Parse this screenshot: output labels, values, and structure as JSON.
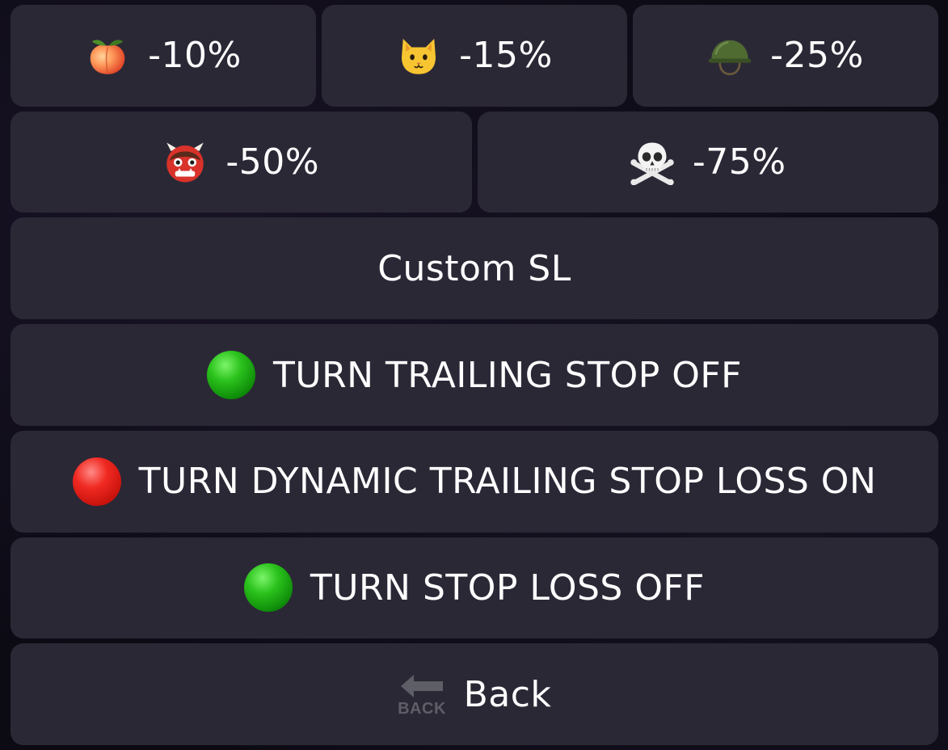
{
  "keyboard": {
    "row1": [
      {
        "label": "-10%",
        "icon": "peach-icon"
      },
      {
        "label": "-15%",
        "icon": "cat-icon"
      },
      {
        "label": "-25%",
        "icon": "military-helmet-icon"
      }
    ],
    "row2": [
      {
        "label": "-50%",
        "icon": "ogre-icon"
      },
      {
        "label": "-75%",
        "icon": "skull-crossbones-icon"
      }
    ],
    "custom_sl": "Custom SL",
    "trailing_stop": {
      "label": "TURN TRAILING STOP OFF",
      "status": "green",
      "status_color": "#2bc21c"
    },
    "dynamic_trailing": {
      "label": "TURN DYNAMIC TRAILING STOP LOSS ON",
      "status": "red",
      "status_color": "#f02a22"
    },
    "stop_loss": {
      "label": "TURN STOP LOSS OFF",
      "status": "green",
      "status_color": "#2bc21c"
    },
    "back": {
      "label": "Back",
      "icon_text": "BACK",
      "icon": "back-arrow-icon"
    }
  },
  "colors": {
    "button_bg": "#2b2836",
    "background": "#0c0b14",
    "text": "#ffffff"
  }
}
